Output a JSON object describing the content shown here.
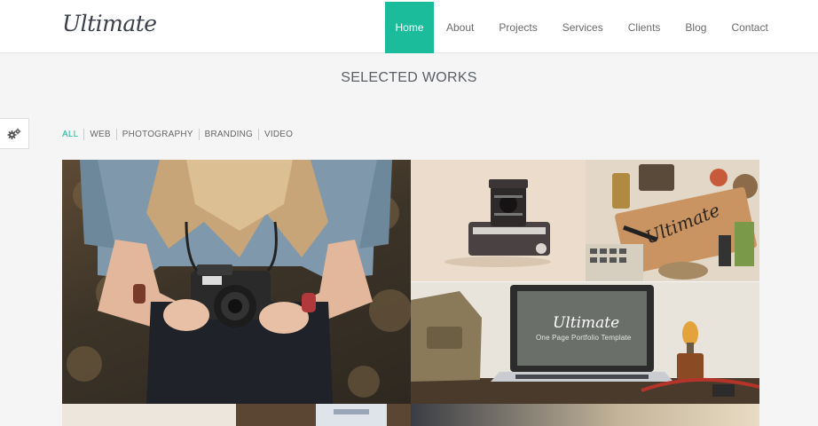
{
  "brand": {
    "logo": "Ultimate"
  },
  "nav": {
    "items": [
      {
        "label": "Home",
        "active": true
      },
      {
        "label": "About"
      },
      {
        "label": "Projects"
      },
      {
        "label": "Services"
      },
      {
        "label": "Clients"
      },
      {
        "label": "Blog"
      },
      {
        "label": "Contact"
      }
    ]
  },
  "section": {
    "title": "SELECTED WORKS"
  },
  "filters": [
    "ALL",
    "WEB",
    "PHOTOGRAPHY",
    "BRANDING",
    "VIDEO"
  ],
  "gallery": {
    "laptop_title": "Ultimate",
    "laptop_subtitle": "One Page Portfolio Template",
    "desk_card_text": "Ultimate"
  },
  "colors": {
    "accent": "#1abc9c",
    "background": "#f5f5f5",
    "header": "#ffffff"
  },
  "icons": {
    "settings": "gears-icon"
  }
}
